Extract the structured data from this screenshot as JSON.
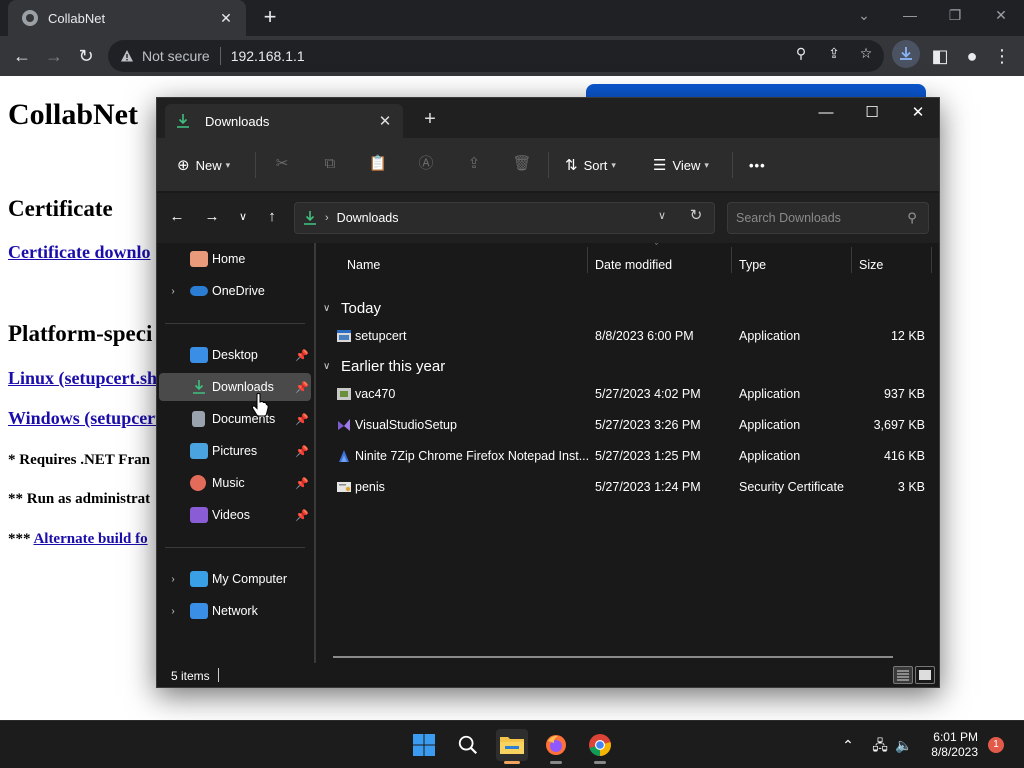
{
  "browser": {
    "tab_title": "CollabNet",
    "tab_close": "✕",
    "new_tab": "+",
    "security_label": "Not secure",
    "url": "192.168.1.1"
  },
  "page": {
    "title": "CollabNet",
    "certificate_heading": "Certificate",
    "certificate_link": "Certificate downlo",
    "platform_heading": "Platform-speci",
    "linux_link": "Linux (setupcert.sh",
    "windows_link": "Windows (setupcert",
    "note1": "* Requires .NET Fran",
    "note2": "** Run as administrat",
    "note3_prefix": "***",
    "note3_link": "Alternate build fo"
  },
  "explorer": {
    "tab_label": "Downloads",
    "command_bar": {
      "new_label": "New",
      "sort_label": "Sort",
      "view_label": "View",
      "more_label": "•••"
    },
    "address": {
      "crumb": "Downloads",
      "search_placeholder": "Search Downloads"
    },
    "nav": {
      "items": [
        {
          "label": "Home",
          "expandable": false,
          "pinned": false,
          "selected": false
        },
        {
          "label": "OneDrive",
          "expandable": true,
          "pinned": false,
          "selected": false
        },
        {
          "label": "Desktop",
          "expandable": false,
          "pinned": true,
          "selected": false
        },
        {
          "label": "Downloads",
          "expandable": false,
          "pinned": true,
          "selected": true
        },
        {
          "label": "Documents",
          "expandable": false,
          "pinned": true,
          "selected": false
        },
        {
          "label": "Pictures",
          "expandable": false,
          "pinned": true,
          "selected": false
        },
        {
          "label": "Music",
          "expandable": false,
          "pinned": true,
          "selected": false
        },
        {
          "label": "Videos",
          "expandable": false,
          "pinned": true,
          "selected": false
        },
        {
          "label": "My Computer",
          "expandable": true,
          "pinned": false,
          "selected": false
        },
        {
          "label": "Network",
          "expandable": true,
          "pinned": false,
          "selected": false
        }
      ]
    },
    "columns": {
      "name": "Name",
      "date": "Date modified",
      "type": "Type",
      "size": "Size"
    },
    "groups": {
      "today": "Today",
      "earlier": "Earlier this year"
    },
    "files": [
      {
        "name": "setupcert",
        "date": "8/8/2023 6:00 PM",
        "type": "Application",
        "size": "12 KB",
        "icon": "app-window-icon"
      },
      {
        "name": "vac470",
        "date": "5/27/2023 4:02 PM",
        "type": "Application",
        "size": "937 KB",
        "icon": "installer-icon"
      },
      {
        "name": "VisualStudioSetup",
        "date": "5/27/2023 3:26 PM",
        "type": "Application",
        "size": "3,697 KB",
        "icon": "visual-studio-icon"
      },
      {
        "name": "Ninite 7Zip Chrome Firefox Notepad Inst...",
        "date": "5/27/2023 1:25 PM",
        "type": "Application",
        "size": "416 KB",
        "icon": "ninite-icon"
      },
      {
        "name": "penis",
        "date": "5/27/2023 1:24 PM",
        "type": "Security Certificate",
        "size": "3 KB",
        "icon": "certificate-icon"
      }
    ],
    "status": {
      "item_count": "5 items"
    }
  },
  "taskbar": {
    "time": "6:01 PM",
    "date": "8/8/2023",
    "notification_count": "1"
  },
  "colors": {
    "accent_downloads": "#3fbf7f",
    "link": "#1a0dab",
    "explorer_bg": "#191919",
    "selected_nav": "#4a4a4a"
  }
}
